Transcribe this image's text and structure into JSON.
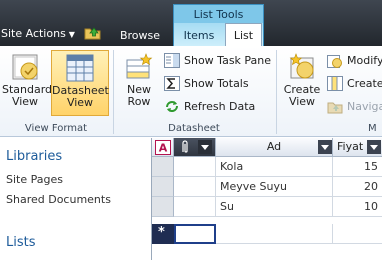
{
  "topbar": {
    "site_actions_label": "Site Actions",
    "browse_tab": "Browse",
    "context_group": "List Tools",
    "tabs": [
      {
        "label": "Items"
      },
      {
        "label": "List"
      }
    ],
    "active_tab": "List"
  },
  "ribbon": {
    "groups": [
      {
        "label": "View Format",
        "buttons": [
          {
            "label_line1": "Standard",
            "label_line2": "View",
            "icon": "standard-view-icon"
          },
          {
            "label_line1": "Datasheet",
            "label_line2": "View",
            "icon": "datasheet-view-icon",
            "selected": true
          }
        ]
      },
      {
        "label": "Datasheet",
        "buttons": [
          {
            "label_line1": "New",
            "label_line2": "Row",
            "icon": "new-row-icon"
          },
          {
            "label": "Show Task Pane",
            "icon": "task-pane-icon"
          },
          {
            "label": "Show Totals",
            "icon": "sigma-icon"
          },
          {
            "label": "Refresh Data",
            "icon": "refresh-icon"
          }
        ]
      },
      {
        "label": "M",
        "buttons": [
          {
            "label_line1": "Create",
            "label_line2": "View",
            "icon": "create-view-icon"
          },
          {
            "label": "Modify",
            "icon": "modify-view-icon"
          },
          {
            "label": "Create",
            "icon": "create-column-icon"
          },
          {
            "label": "Naviga",
            "icon": "navigate-up-icon",
            "disabled": true
          }
        ]
      }
    ]
  },
  "leftnav": {
    "sections": [
      {
        "heading": "Libraries",
        "items": [
          "Site Pages",
          "Shared Documents"
        ]
      },
      {
        "heading": "Lists",
        "items": []
      }
    ]
  },
  "grid": {
    "columns": [
      "Ad",
      "Fiyat"
    ],
    "rows": [
      {
        "ad": "Kola",
        "fiyat": "15"
      },
      {
        "ad": "Meyve Suyu",
        "fiyat": "20"
      },
      {
        "ad": "Su",
        "fiyat": "10"
      }
    ],
    "new_row_marker": "*"
  },
  "colors": {
    "topbar": "#2e343c",
    "context_tab": "#7ec7e9",
    "selected_button": "#ffd36a",
    "nav_heading": "#1d5b9a"
  }
}
